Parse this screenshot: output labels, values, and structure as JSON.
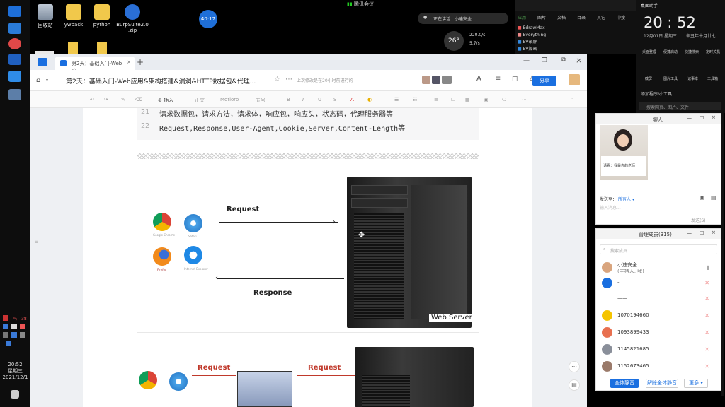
{
  "taskbar": {
    "time": "20:52",
    "weekday": "星期三",
    "date": "2021/12/1",
    "tray_label": "吗：38"
  },
  "desktop": {
    "icons": [
      {
        "label": "回收站"
      },
      {
        "label": "ywback"
      },
      {
        "label": "python"
      },
      {
        "label": "BurpSuite2.0 .zip"
      }
    ],
    "meeting_timer": "40:17",
    "temperature": "26°",
    "cpu_line1": "220.0/s",
    "cpu_line2": "5.7/s",
    "network_label": "腾讯会议",
    "speaking_label": "正在讲话：小迪安全"
  },
  "start_panel": {
    "tabs": [
      "应用",
      "图片",
      "文档",
      "目录",
      "其它",
      "中搜"
    ],
    "apps": [
      "EdrawMax",
      "Everything",
      "EV录屏",
      "EV加密"
    ]
  },
  "clock_widget": {
    "title": "桌面助手",
    "time": "20 : 52",
    "date": "12月01日 星期三",
    "lunar": "辛丑年十月廿七",
    "row1": [
      "桌面整理",
      "便捷启动",
      "快捷搜索",
      "定时关机"
    ],
    "row2": [
      "截屏",
      "图片工具",
      "记事本",
      "工具箱"
    ],
    "add_label": "添加程序/小工具",
    "search_placeholder": "搜索网页、图片、文件"
  },
  "browser": {
    "tab_title": "第2天：基础入门-Web应...",
    "doc_title": "第2天：基础入门-Web应用&架构搭建&漏洞&HTTP数据包&代理...",
    "save_status": "上次修改是在20小时前进行的",
    "share_button": "分享",
    "toolbar": {
      "insert": "插入",
      "style": "正文",
      "font": "Motioro",
      "size": "五号",
      "bold": "B",
      "italic": "I",
      "underline": "U",
      "strike": "S"
    }
  },
  "document": {
    "code_lines": [
      {
        "num": "21",
        "text": "请求数据包，请求方法，请求体，响应包，响应头，状态码，代理服务器等"
      },
      {
        "num": "22",
        "text": "Request,Response,User-Agent,Cookie,Server,Content-Length等"
      }
    ],
    "figure1": {
      "request_label": "Request",
      "response_label": "Response",
      "server_label": "Web Server",
      "browser_names": [
        "Google Chrome",
        "Safari",
        "Firefox",
        "Internet Explorer"
      ]
    },
    "figure2": {
      "request_label_1": "Request",
      "request_label_2": "Request"
    }
  },
  "chat_panel": {
    "title": "聊天",
    "video_caption": "请看：我是你的老师",
    "send_to_label": "发送至：",
    "send_to_value": "所有人",
    "input_placeholder": "输入消息...",
    "send_button": "发送(S)"
  },
  "members_panel": {
    "title": "管理成员(315)",
    "search_placeholder": "搜索成员",
    "members": [
      {
        "name": "小迪安全",
        "sub": "(主持人, 我)"
      },
      {
        "name": "-",
        "sub": ""
      },
      {
        "name": "——",
        "sub": ""
      },
      {
        "name": "1070194660",
        "sub": ""
      },
      {
        "name": "1093899433",
        "sub": ""
      },
      {
        "name": "1145821685",
        "sub": ""
      },
      {
        "name": "1152673465",
        "sub": ""
      }
    ],
    "mute_all": "全体静音",
    "unmute_all": "解除全体静音",
    "more": "更多"
  },
  "colors": {
    "accent": "#1a6fe0",
    "muted_mic": "#f09090"
  }
}
